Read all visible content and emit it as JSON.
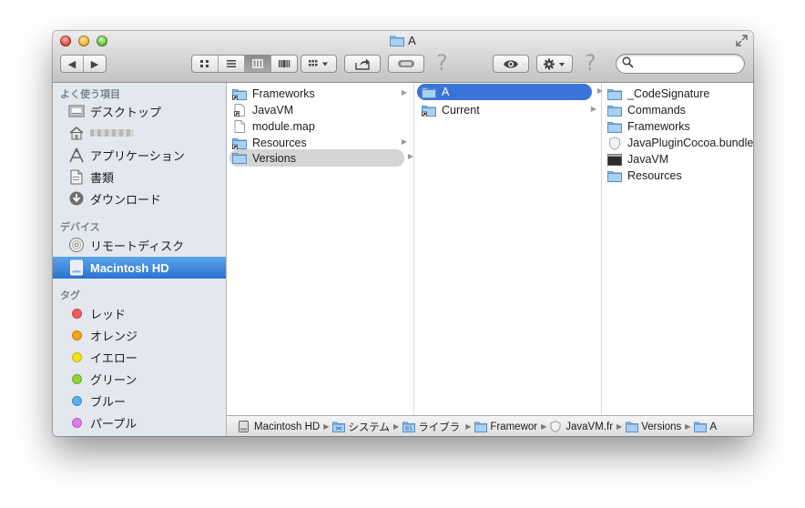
{
  "window": {
    "title": "A",
    "nav": {
      "back": "◀",
      "forward": "▶"
    },
    "toolbar_icons": [
      "icon-view-icon",
      "list-view-icon",
      "column-view-icon",
      "coverflow-view-icon",
      "arrange-menu-icon",
      "share-icon",
      "tag-icon",
      "quicklook-eye-icon",
      "action-gear-icon",
      "search-icon"
    ]
  },
  "sidebar": {
    "favorites_header": "よく使う項目",
    "favorites": [
      {
        "label": "デスクトップ",
        "icon": "desktop-icon"
      },
      {
        "label": "",
        "icon": "home-icon"
      },
      {
        "label": "アプリケーション",
        "icon": "applications-icon"
      },
      {
        "label": "書類",
        "icon": "documents-icon"
      },
      {
        "label": "ダウンロード",
        "icon": "downloads-icon"
      }
    ],
    "devices_header": "デバイス",
    "devices": [
      {
        "label": "リモートディスク",
        "icon": "remote-disc-icon"
      },
      {
        "label": "Macintosh HD",
        "icon": "hard-drive-icon",
        "selected": true
      }
    ],
    "tags_header": "タグ",
    "tags": [
      {
        "label": "レッド",
        "color": "#f25c5c"
      },
      {
        "label": "オレンジ",
        "color": "#f7a21b"
      },
      {
        "label": "イエロー",
        "color": "#f2e21b"
      },
      {
        "label": "グリーン",
        "color": "#8fd337"
      },
      {
        "label": "ブルー",
        "color": "#5aaef0"
      },
      {
        "label": "パープル",
        "color": "#e07ae8"
      }
    ]
  },
  "columns": [
    {
      "items": [
        {
          "label": "Frameworks",
          "icon": "folder-alias-icon",
          "has_children": true
        },
        {
          "label": "JavaVM",
          "icon": "file-alias-icon",
          "has_children": false
        },
        {
          "label": "module.map",
          "icon": "document-icon",
          "has_children": false
        },
        {
          "label": "Resources",
          "icon": "folder-alias-icon",
          "has_children": true
        },
        {
          "label": "Versions",
          "icon": "folder-icon",
          "has_children": true,
          "state": "highlighted"
        }
      ]
    },
    {
      "items": [
        {
          "label": "A",
          "icon": "folder-icon",
          "has_children": true,
          "state": "selected"
        },
        {
          "label": "Current",
          "icon": "folder-alias-icon",
          "has_children": true
        }
      ]
    },
    {
      "items": [
        {
          "label": "_CodeSignature",
          "icon": "folder-icon"
        },
        {
          "label": "Commands",
          "icon": "folder-icon"
        },
        {
          "label": "Frameworks",
          "icon": "folder-icon"
        },
        {
          "label": "JavaPluginCocoa.bundle",
          "icon": "bundle-icon"
        },
        {
          "label": "JavaVM",
          "icon": "executable-icon"
        },
        {
          "label": "Resources",
          "icon": "folder-icon"
        }
      ]
    }
  ],
  "pathbar": [
    {
      "label": "Macintosh HD",
      "icon": "hard-drive-icon"
    },
    {
      "label": "システム",
      "icon": "system-folder-icon"
    },
    {
      "label": "ライブラリ",
      "icon": "library-folder-icon"
    },
    {
      "label": "Framewor",
      "icon": "folder-icon"
    },
    {
      "label": "JavaVM.fr",
      "icon": "bundle-icon"
    },
    {
      "label": "Versions",
      "icon": "folder-icon"
    },
    {
      "label": "A",
      "icon": "folder-icon"
    }
  ]
}
